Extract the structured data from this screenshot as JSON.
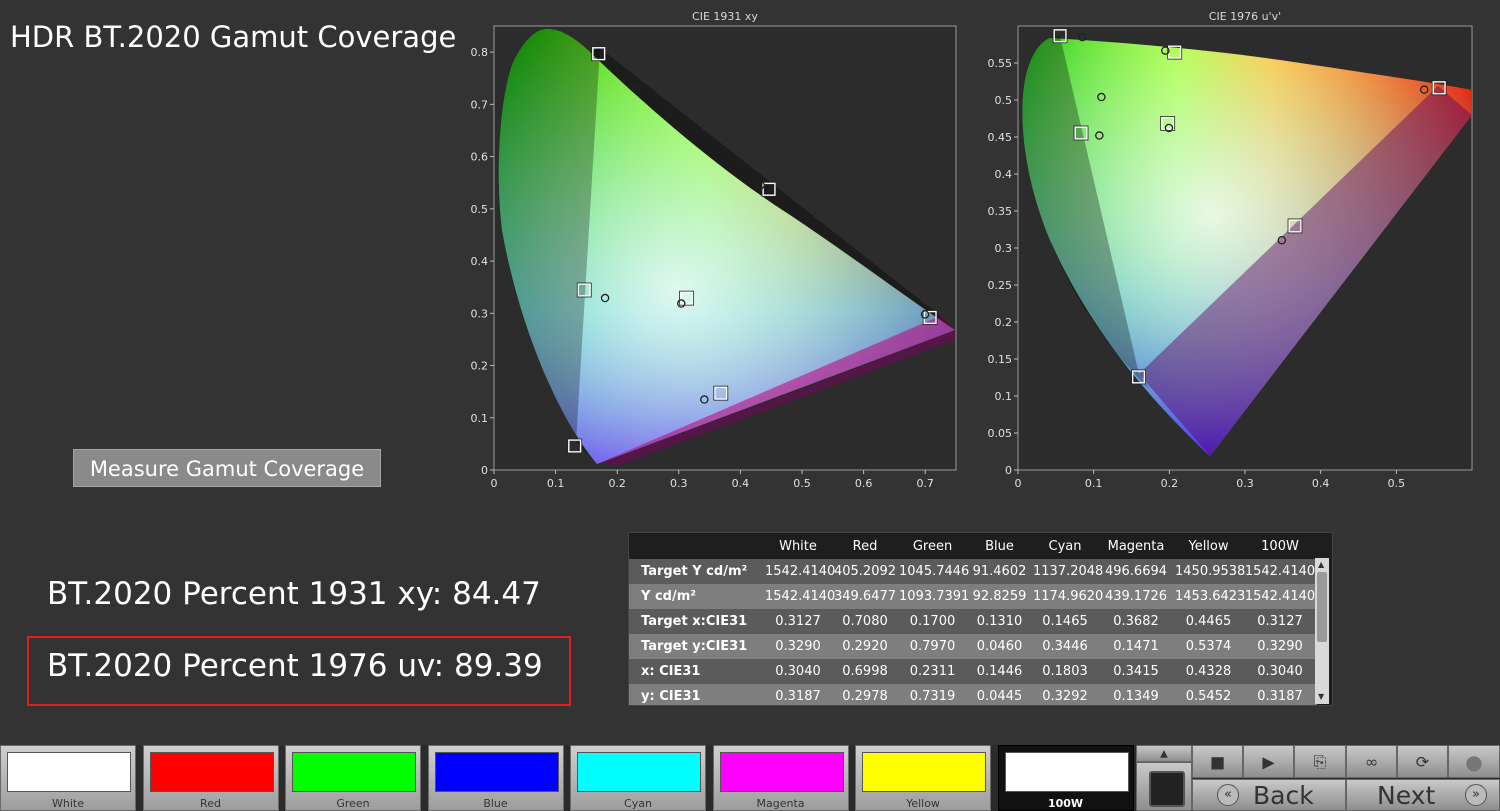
{
  "title": "HDR BT.2020  Gamut Coverage",
  "measure_button": "Measure Gamut Coverage",
  "percent_xy": "BT.2020 Percent 1931 xy: 84.47",
  "percent_uv": "BT.2020 Percent 1976 uv: 89.39",
  "chart_data": [
    {
      "type": "scatter",
      "title": "CIE 1931 xy",
      "xlim": [
        0,
        0.75
      ],
      "ylim": [
        0,
        0.85
      ],
      "x_ticks": [
        "0",
        "0.1",
        "0.2",
        "0.3",
        "0.4",
        "0.5",
        "0.6",
        "0.7"
      ],
      "y_ticks": [
        "0",
        "0.1",
        "0.2",
        "0.3",
        "0.4",
        "0.5",
        "0.6",
        "0.7",
        "0.8"
      ],
      "series": [
        {
          "points": [
            [
              0.708,
              0.292
            ],
            [
              0.17,
              0.797
            ],
            [
              0.131,
              0.046
            ],
            [
              0.1465,
              0.3446
            ],
            [
              0.3682,
              0.1471
            ],
            [
              0.4465,
              0.5374
            ],
            [
              0.3127,
              0.329
            ]
          ]
        },
        {
          "points": [
            [
              0.6998,
              0.2978
            ],
            [
              0.2311,
              0.7319
            ],
            [
              0.1803,
              0.3292
            ],
            [
              0.3415,
              0.1349
            ],
            [
              0.4328,
              0.5452
            ],
            [
              0.304,
              0.3187
            ]
          ]
        }
      ]
    },
    {
      "type": "scatter",
      "title": "CIE 1976 u'v'",
      "xlim": [
        0,
        0.6
      ],
      "ylim": [
        0,
        0.6
      ],
      "x_ticks": [
        "0",
        "0.1",
        "0.2",
        "0.3",
        "0.4",
        "0.5"
      ],
      "y_ticks": [
        "0",
        "0.05",
        "0.1",
        "0.15",
        "0.2",
        "0.25",
        "0.3",
        "0.35",
        "0.4",
        "0.45",
        "0.5",
        "0.55"
      ],
      "series": [
        {
          "points": [
            [
              0.5566,
              0.5165
            ],
            [
              0.0556,
              0.5868
            ],
            [
              0.1593,
              0.1258
            ],
            [
              0.0833,
              0.4554
            ],
            [
              0.3661,
              0.3298
            ],
            [
              0.2071,
              0.5647
            ],
            [
              0.1978,
              0.4683
            ]
          ]
        },
        {
          "points": [
            [
              0.5369,
              0.514
            ],
            [
              0.0851,
              0.5849
            ],
            [
              0.1102,
              0.504
            ],
            [
              0.1075,
              0.452
            ],
            [
              0.3487,
              0.3105
            ],
            [
              0.1947,
              0.5668
            ],
            [
              0.1995,
              0.4622
            ]
          ]
        }
      ]
    }
  ],
  "table": {
    "columns": [
      "",
      "White",
      "Red",
      "Green",
      "Blue",
      "Cyan",
      "Magenta",
      "Yellow",
      "100W"
    ],
    "rows": [
      [
        "Target Y cd/m²",
        "1542.4140",
        "405.2092",
        "1045.7446",
        "91.4602",
        "1137.2048",
        "496.6694",
        "1450.9538",
        "1542.4140"
      ],
      [
        "Y cd/m²",
        "1542.4140",
        "349.6477",
        "1093.7391",
        "92.8259",
        "1174.9620",
        "439.1726",
        "1453.6423",
        "1542.4140"
      ],
      [
        "Target x:CIE31",
        "0.3127",
        "0.7080",
        "0.1700",
        "0.1310",
        "0.1465",
        "0.3682",
        "0.4465",
        "0.3127"
      ],
      [
        "Target y:CIE31",
        "0.3290",
        "0.2920",
        "0.7970",
        "0.0460",
        "0.3446",
        "0.1471",
        "0.5374",
        "0.3290"
      ],
      [
        "x: CIE31",
        "0.3040",
        "0.6998",
        "0.2311",
        "0.1446",
        "0.1803",
        "0.3415",
        "0.4328",
        "0.3040"
      ],
      [
        "y: CIE31",
        "0.3187",
        "0.2978",
        "0.7319",
        "0.0445",
        "0.3292",
        "0.1349",
        "0.5452",
        "0.3187"
      ]
    ]
  },
  "swatches": [
    {
      "label": "White",
      "color": "#ffffff"
    },
    {
      "label": "Red",
      "color": "#ff0000"
    },
    {
      "label": "Green",
      "color": "#00ff00"
    },
    {
      "label": "Blue",
      "color": "#0000ff"
    },
    {
      "label": "Cyan",
      "color": "#00ffff"
    },
    {
      "label": "Magenta",
      "color": "#ff00ff"
    },
    {
      "label": "Yellow",
      "color": "#ffff00"
    },
    {
      "label": "100W",
      "color": "#ffffff",
      "active": true
    }
  ],
  "controls": {
    "up_icon": "triangle-up-icon",
    "stop_icon": "stop-icon",
    "play_icon": "play-icon",
    "save_icon": "save-icon",
    "loop_icon": "infinity-icon",
    "refresh_icon": "refresh-icon",
    "back_label": "Back",
    "next_label": "Next"
  },
  "colors": {
    "highlight_box": "#e41e1e",
    "background": "#333333",
    "plot_bg": "#2c2c2c"
  }
}
